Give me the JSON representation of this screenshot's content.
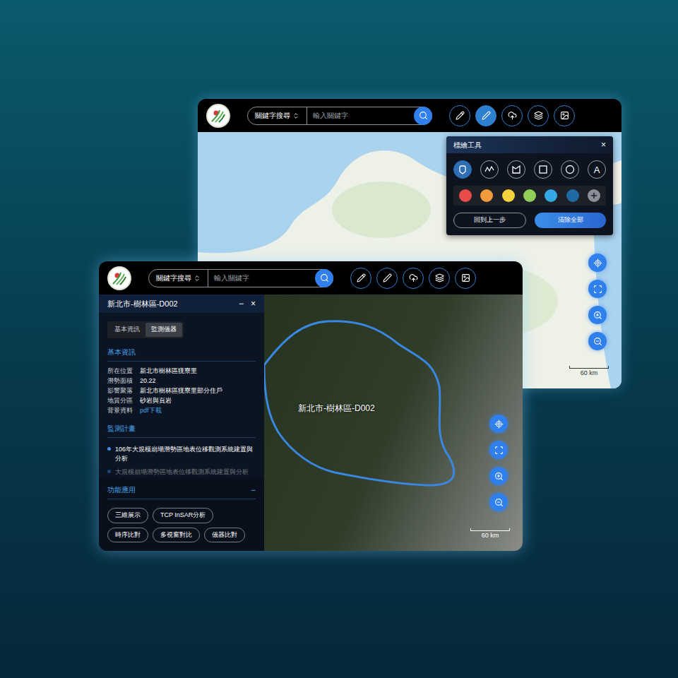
{
  "back_window": {
    "header": {
      "search_mode": "關鍵字搜尋",
      "placeholder": "輸入關鍵字",
      "toolbar": [
        {
          "kind": "pencil",
          "selected": false
        },
        {
          "kind": "pen",
          "selected": true
        },
        {
          "kind": "upload",
          "selected": false
        },
        {
          "kind": "layers",
          "selected": false
        },
        {
          "kind": "image",
          "selected": false
        }
      ]
    },
    "annotation_panel": {
      "title": "標繪工具",
      "close": "×",
      "tools": [
        {
          "kind": "pin",
          "selected": true
        },
        {
          "kind": "polyline",
          "selected": false
        },
        {
          "kind": "polygon",
          "selected": false
        },
        {
          "kind": "square",
          "selected": false
        },
        {
          "kind": "circle",
          "selected": false
        },
        {
          "kind": "text",
          "label": "A",
          "selected": false
        }
      ],
      "colors": [
        {
          "color": "#e94b4b"
        },
        {
          "color": "#f29a3c"
        },
        {
          "color": "#f3d23c"
        },
        {
          "color": "#8fcf5a"
        },
        {
          "color": "#35a7e6"
        },
        {
          "color": "#1f6aa5"
        }
      ],
      "buttons": [
        {
          "label": "回到上一步",
          "primary": false
        },
        {
          "label": "清除全部",
          "primary": true
        }
      ]
    },
    "map": {
      "scale": "60 km"
    }
  },
  "front_window": {
    "header": {
      "search_mode": "關鍵字搜尋",
      "placeholder": "輸入關鍵字",
      "toolbar": [
        {
          "kind": "pencil",
          "selected": false
        },
        {
          "kind": "pen",
          "selected": false
        },
        {
          "kind": "upload",
          "selected": false
        },
        {
          "kind": "layers",
          "selected": false
        },
        {
          "kind": "image",
          "selected": false
        }
      ]
    },
    "detail_panel": {
      "title": "新北市-樹林區-D002",
      "minimize": "−",
      "close": "×",
      "tabs": [
        {
          "label": "基本資訊",
          "selected": false
        },
        {
          "label": "監測儀器",
          "selected": true
        }
      ],
      "basic_info": {
        "heading": "基本資訊",
        "rows": [
          {
            "label": "所在位置",
            "value": "新北市樹林區猐寮里",
            "link": false
          },
          {
            "label": "潛勢面積",
            "value": "20.22",
            "link": false
          },
          {
            "label": "影響聚落",
            "value": "新北市樹林區猐寮里部分住戶",
            "link": false
          },
          {
            "label": "地質分區",
            "value": "砂岩與頁岩",
            "link": false
          },
          {
            "label": "背景資料",
            "value": "pdf下載",
            "link": true
          }
        ]
      },
      "plans": {
        "heading": "監測計畫",
        "items": [
          {
            "text": "106年大規模崩塌潛勢區地表位移觀測系統建置與分析",
            "faded": false
          },
          {
            "text": "大規模崩塌潛勢區地表位移觀測系統建置與分析",
            "faded": true
          }
        ]
      },
      "functions": {
        "heading": "功能應用",
        "toggle": "−",
        "buttons": [
          "三維展示",
          "TCP InSAR分析",
          "時序比對",
          "多視窗對比",
          "儀器比對"
        ]
      }
    },
    "map": {
      "label": "新北市-樹林區-D002",
      "scale": "60 km"
    }
  }
}
